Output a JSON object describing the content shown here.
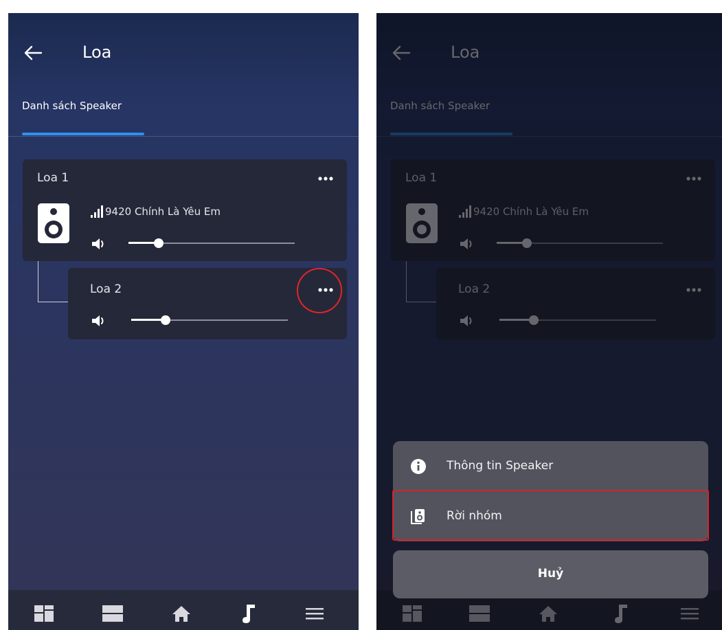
{
  "screen": {
    "title": "Loa",
    "tab": "Danh sách Speaker",
    "speakers": [
      {
        "name": "Loa 1",
        "song": "9420 Chính Là Yêu Em",
        "volume": 0.18
      },
      {
        "name": "Loa 2",
        "volume": 0.22
      }
    ],
    "nav_items": [
      "dashboard-icon",
      "rooms-icon",
      "home-icon",
      "music-icon",
      "menu-icon"
    ],
    "active_nav": "music-icon"
  },
  "action_sheet": {
    "options": [
      {
        "label": "Thông tin Speaker",
        "icon": "info-icon"
      },
      {
        "label": "Rời nhóm",
        "icon": "speaker-icon"
      }
    ],
    "cancel_label": "Huỷ"
  },
  "colors": {
    "accent": "#2f8ff0",
    "highlight_red": "#e0252a",
    "card": "#252839",
    "sheet": "#52535d"
  }
}
